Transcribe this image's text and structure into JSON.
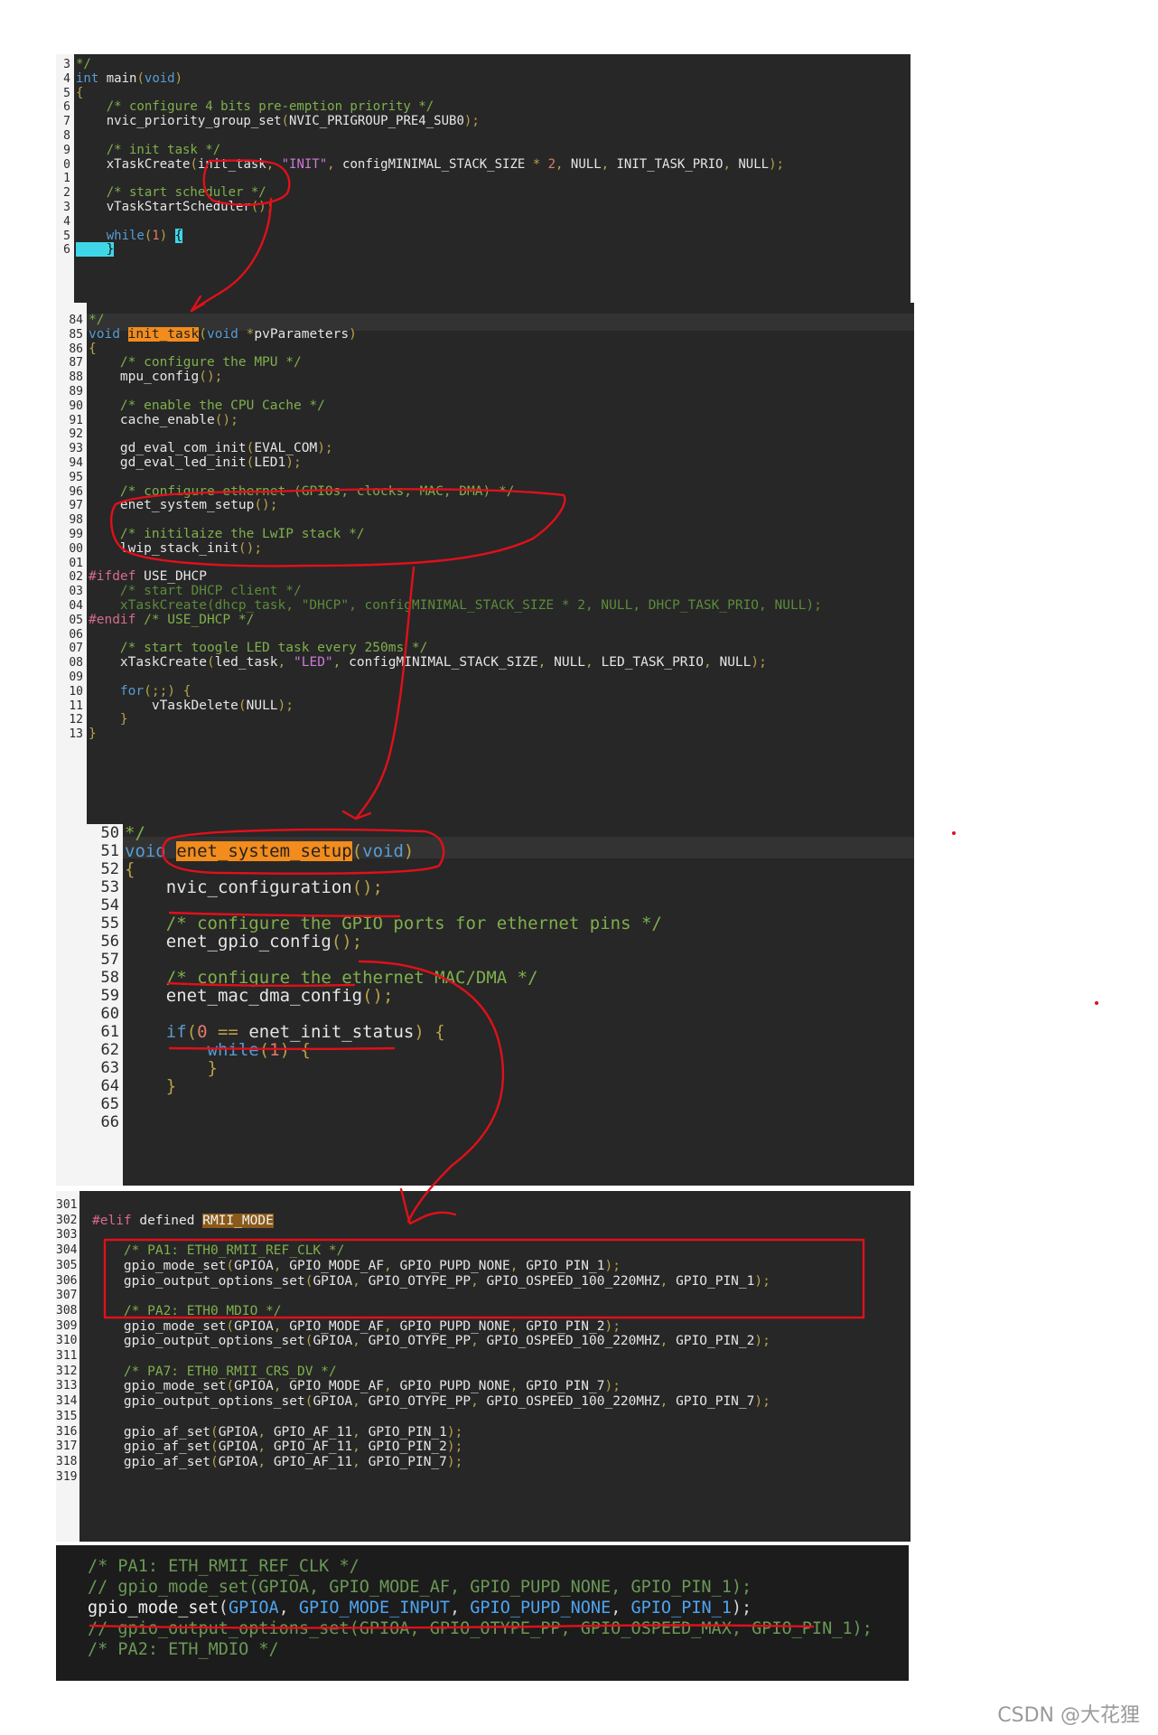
{
  "panel1": {
    "line_numbers": [
      "3",
      "4",
      "5",
      "6",
      "7",
      "8",
      "9",
      "0",
      "1",
      "2",
      "3",
      "4",
      "5",
      "6"
    ],
    "lines": [
      [
        [
          "cm",
          "*/"
        ]
      ],
      [
        [
          "kw",
          "int"
        ],
        [
          "id",
          " main"
        ],
        [
          "pn",
          "("
        ],
        [
          "kw",
          "void"
        ],
        [
          "pn",
          ")"
        ]
      ],
      [
        [
          "pn",
          "{"
        ]
      ],
      [
        [
          "cm",
          "    /* configure 4 bits pre-emption priority */"
        ]
      ],
      [
        [
          "id",
          "    nvic_priority_group_set"
        ],
        [
          "pn",
          "("
        ],
        [
          "id",
          "NVIC_PRIGROUP_PRE4_SUB0"
        ],
        [
          "pn",
          ");"
        ]
      ],
      [
        [
          "id",
          ""
        ]
      ],
      [
        [
          "cm",
          "    /* init task */"
        ]
      ],
      [
        [
          "id",
          "    xTaskCreate"
        ],
        [
          "pn",
          "("
        ],
        [
          "id",
          "init_task"
        ],
        [
          "pn",
          ", "
        ],
        [
          "str",
          "\"INIT\""
        ],
        [
          "pn",
          ", "
        ],
        [
          "id",
          "configMINIMAL_STACK_SIZE "
        ],
        [
          "pn",
          "* "
        ],
        [
          "num",
          "2"
        ],
        [
          "pn",
          ", "
        ],
        [
          "id",
          "NULL"
        ],
        [
          "pn",
          ", "
        ],
        [
          "id",
          "INIT_TASK_PRIO"
        ],
        [
          "pn",
          ", "
        ],
        [
          "id",
          "NULL"
        ],
        [
          "pn",
          ");"
        ]
      ],
      [
        [
          "id",
          ""
        ]
      ],
      [
        [
          "cm",
          "    /* start scheduler */"
        ]
      ],
      [
        [
          "id",
          "    vTaskStartScheduler"
        ],
        [
          "pn",
          "();"
        ]
      ],
      [
        [
          "id",
          ""
        ]
      ],
      [
        [
          "kw",
          "    while"
        ],
        [
          "pn",
          "("
        ],
        [
          "num",
          "1"
        ],
        [
          "pn",
          ") "
        ],
        [
          "cursor",
          "{"
        ]
      ],
      [
        [
          "cursor",
          "    }"
        ]
      ]
    ]
  },
  "panel2": {
    "line_numbers": [
      "84",
      "85",
      "86",
      "87",
      "88",
      "89",
      "90",
      "91",
      "92",
      "93",
      "94",
      "95",
      "96",
      "97",
      "98",
      "99",
      "00",
      "01",
      "02",
      "03",
      "04",
      "05",
      "06",
      "07",
      "08",
      "09",
      "10",
      "11",
      "12",
      "13"
    ],
    "lines": [
      [
        [
          "cm",
          "*/"
        ]
      ],
      [
        [
          "kw",
          "void "
        ],
        [
          "hl",
          "init_task"
        ],
        [
          "pn",
          "("
        ],
        [
          "kw",
          "void "
        ],
        [
          "pn",
          "*"
        ],
        [
          "id",
          "pvParameters"
        ],
        [
          "pn",
          ")"
        ]
      ],
      [
        [
          "pn",
          "{"
        ]
      ],
      [
        [
          "cm",
          "    /* configure the MPU */"
        ]
      ],
      [
        [
          "id",
          "    mpu_config"
        ],
        [
          "pn",
          "();"
        ]
      ],
      [
        [
          "id",
          ""
        ]
      ],
      [
        [
          "cm",
          "    /* enable the CPU Cache */"
        ]
      ],
      [
        [
          "id",
          "    cache_enable"
        ],
        [
          "pn",
          "();"
        ]
      ],
      [
        [
          "id",
          ""
        ]
      ],
      [
        [
          "id",
          "    gd_eval_com_init"
        ],
        [
          "pn",
          "("
        ],
        [
          "id",
          "EVAL_COM"
        ],
        [
          "pn",
          ");"
        ]
      ],
      [
        [
          "id",
          "    gd_eval_led_init"
        ],
        [
          "pn",
          "("
        ],
        [
          "id",
          "LED1"
        ],
        [
          "pn",
          ");"
        ]
      ],
      [
        [
          "id",
          ""
        ]
      ],
      [
        [
          "cm",
          "    /* configure ethernet (GPIOs, clocks, MAC, DMA) */"
        ]
      ],
      [
        [
          "id",
          "    enet_system_setup"
        ],
        [
          "pn",
          "();"
        ]
      ],
      [
        [
          "id",
          ""
        ]
      ],
      [
        [
          "cm",
          "    /* initilaize the LwIP stack */"
        ]
      ],
      [
        [
          "id",
          "    lwip_stack_init"
        ],
        [
          "pn",
          "();"
        ]
      ],
      [
        [
          "id",
          ""
        ]
      ],
      [
        [
          "pp",
          "#ifdef "
        ],
        [
          "id",
          "USE_DHCP"
        ]
      ],
      [
        [
          "dim",
          "    /* start DHCP client */"
        ]
      ],
      [
        [
          "dim",
          "    xTaskCreate(dhcp_task, \"DHCP\", configMINIMAL_STACK_SIZE * 2, NULL, DHCP_TASK_PRIO, NULL);"
        ]
      ],
      [
        [
          "pp",
          "#endif "
        ],
        [
          "cm",
          "/* USE_DHCP */"
        ]
      ],
      [
        [
          "id",
          ""
        ]
      ],
      [
        [
          "cm",
          "    /* start toogle LED task every 250ms */"
        ]
      ],
      [
        [
          "id",
          "    xTaskCreate"
        ],
        [
          "pn",
          "("
        ],
        [
          "id",
          "led_task"
        ],
        [
          "pn",
          ", "
        ],
        [
          "str",
          "\"LED\""
        ],
        [
          "pn",
          ", "
        ],
        [
          "id",
          "configMINIMAL_STACK_SIZE"
        ],
        [
          "pn",
          ", "
        ],
        [
          "id",
          "NULL"
        ],
        [
          "pn",
          ", "
        ],
        [
          "id",
          "LED_TASK_PRIO"
        ],
        [
          "pn",
          ", "
        ],
        [
          "id",
          "NULL"
        ],
        [
          "pn",
          ");"
        ]
      ],
      [
        [
          "id",
          ""
        ]
      ],
      [
        [
          "kw",
          "    for"
        ],
        [
          "pn",
          "(;;) {"
        ]
      ],
      [
        [
          "id",
          "        vTaskDelete"
        ],
        [
          "pn",
          "("
        ],
        [
          "id",
          "NULL"
        ],
        [
          "pn",
          ");"
        ]
      ],
      [
        [
          "pn",
          "    }"
        ]
      ],
      [
        [
          "pn",
          "}"
        ]
      ]
    ]
  },
  "panel3": {
    "line_numbers": [
      "50",
      "51",
      "52",
      "53",
      "54",
      "55",
      "56",
      "57",
      "58",
      "59",
      "60",
      "61",
      "62",
      "63",
      "64",
      "65",
      "66"
    ],
    "lines": [
      [
        [
          "cm",
          "*/"
        ]
      ],
      [
        [
          "kw",
          "void "
        ],
        [
          "hl",
          "enet_system_setup"
        ],
        [
          "pn",
          "("
        ],
        [
          "kw",
          "void"
        ],
        [
          "pn",
          ")"
        ]
      ],
      [
        [
          "pn",
          "{"
        ]
      ],
      [
        [
          "id",
          "    nvic_configuration"
        ],
        [
          "pn",
          "();"
        ]
      ],
      [
        [
          "id",
          ""
        ]
      ],
      [
        [
          "cm",
          "    /* configure the GPIO ports for ethernet pins */"
        ]
      ],
      [
        [
          "id",
          "    enet_gpio_config"
        ],
        [
          "pn",
          "();"
        ]
      ],
      [
        [
          "id",
          ""
        ]
      ],
      [
        [
          "cm",
          "    /* configure the ethernet MAC/DMA */"
        ]
      ],
      [
        [
          "id",
          "    enet_mac_dma_config"
        ],
        [
          "pn",
          "();"
        ]
      ],
      [
        [
          "id",
          ""
        ]
      ],
      [
        [
          "kw",
          "    if"
        ],
        [
          "pn",
          "("
        ],
        [
          "num",
          "0"
        ],
        [
          "pn",
          " == "
        ],
        [
          "id",
          "enet_init_status"
        ],
        [
          "pn",
          ") {"
        ]
      ],
      [
        [
          "kw",
          "        while"
        ],
        [
          "pn",
          "("
        ],
        [
          "num",
          "1"
        ],
        [
          "pn",
          ") {"
        ]
      ],
      [
        [
          "pn",
          "        }"
        ]
      ],
      [
        [
          "pn",
          "    }"
        ]
      ],
      [
        [
          "id",
          ""
        ]
      ],
      [
        [
          "id",
          ""
        ]
      ]
    ]
  },
  "panel4": {
    "line_numbers": [
      "301",
      "302",
      "303",
      "304",
      "305",
      "306",
      "307",
      "308",
      "309",
      "310",
      "311",
      "312",
      "313",
      "314",
      "315",
      "316",
      "317",
      "318",
      "319"
    ],
    "lines": [
      [
        [
          "id",
          ""
        ]
      ],
      [
        [
          "pp",
          "#elif "
        ],
        [
          "id",
          "defined "
        ],
        [
          "hl2",
          "RMII_MODE"
        ]
      ],
      [
        [
          "id",
          ""
        ]
      ],
      [
        [
          "cm",
          "    /* PA1: ETH0_RMII_REF_CLK */"
        ]
      ],
      [
        [
          "id",
          "    gpio_mode_set"
        ],
        [
          "pn",
          "("
        ],
        [
          "id",
          "GPIOA"
        ],
        [
          "pn",
          ", "
        ],
        [
          "id",
          "GPIO_MODE_AF"
        ],
        [
          "pn",
          ", "
        ],
        [
          "id",
          "GPIO_PUPD_NONE"
        ],
        [
          "pn",
          ", "
        ],
        [
          "id",
          "GPIO_PIN_1"
        ],
        [
          "pn",
          ");"
        ]
      ],
      [
        [
          "id",
          "    gpio_output_options_set"
        ],
        [
          "pn",
          "("
        ],
        [
          "id",
          "GPIOA"
        ],
        [
          "pn",
          ", "
        ],
        [
          "id",
          "GPIO_OTYPE_PP"
        ],
        [
          "pn",
          ", "
        ],
        [
          "id",
          "GPIO_OSPEED_100_220MHZ"
        ],
        [
          "pn",
          ", "
        ],
        [
          "id",
          "GPIO_PIN_1"
        ],
        [
          "pn",
          ");"
        ]
      ],
      [
        [
          "id",
          ""
        ]
      ],
      [
        [
          "cm",
          "    /* PA2: ETH0_MDIO */"
        ]
      ],
      [
        [
          "id",
          "    gpio_mode_set"
        ],
        [
          "pn",
          "("
        ],
        [
          "id",
          "GPIOA"
        ],
        [
          "pn",
          ", "
        ],
        [
          "id",
          "GPIO_MODE_AF"
        ],
        [
          "pn",
          ", "
        ],
        [
          "id",
          "GPIO_PUPD_NONE"
        ],
        [
          "pn",
          ", "
        ],
        [
          "id",
          "GPIO_PIN_2"
        ],
        [
          "pn",
          ");"
        ]
      ],
      [
        [
          "id",
          "    gpio_output_options_set"
        ],
        [
          "pn",
          "("
        ],
        [
          "id",
          "GPIOA"
        ],
        [
          "pn",
          ", "
        ],
        [
          "id",
          "GPIO_OTYPE_PP"
        ],
        [
          "pn",
          ", "
        ],
        [
          "id",
          "GPIO_OSPEED_100_220MHZ"
        ],
        [
          "pn",
          ", "
        ],
        [
          "id",
          "GPIO_PIN_2"
        ],
        [
          "pn",
          ");"
        ]
      ],
      [
        [
          "id",
          ""
        ]
      ],
      [
        [
          "cm",
          "    /* PA7: ETH0_RMII_CRS_DV */"
        ]
      ],
      [
        [
          "id",
          "    gpio_mode_set"
        ],
        [
          "pn",
          "("
        ],
        [
          "id",
          "GPIOA"
        ],
        [
          "pn",
          ", "
        ],
        [
          "id",
          "GPIO_MODE_AF"
        ],
        [
          "pn",
          ", "
        ],
        [
          "id",
          "GPIO_PUPD_NONE"
        ],
        [
          "pn",
          ", "
        ],
        [
          "id",
          "GPIO_PIN_7"
        ],
        [
          "pn",
          ");"
        ]
      ],
      [
        [
          "id",
          "    gpio_output_options_set"
        ],
        [
          "pn",
          "("
        ],
        [
          "id",
          "GPIOA"
        ],
        [
          "pn",
          ", "
        ],
        [
          "id",
          "GPIO_OTYPE_PP"
        ],
        [
          "pn",
          ", "
        ],
        [
          "id",
          "GPIO_OSPEED_100_220MHZ"
        ],
        [
          "pn",
          ", "
        ],
        [
          "id",
          "GPIO_PIN_7"
        ],
        [
          "pn",
          ");"
        ]
      ],
      [
        [
          "id",
          ""
        ]
      ],
      [
        [
          "id",
          "    gpio_af_set"
        ],
        [
          "pn",
          "("
        ],
        [
          "id",
          "GPIOA"
        ],
        [
          "pn",
          ", "
        ],
        [
          "id",
          "GPIO_AF_11"
        ],
        [
          "pn",
          ", "
        ],
        [
          "id",
          "GPIO_PIN_1"
        ],
        [
          "pn",
          ");"
        ]
      ],
      [
        [
          "id",
          "    gpio_af_set"
        ],
        [
          "pn",
          "("
        ],
        [
          "id",
          "GPIOA"
        ],
        [
          "pn",
          ", "
        ],
        [
          "id",
          "GPIO_AF_11"
        ],
        [
          "pn",
          ", "
        ],
        [
          "id",
          "GPIO_PIN_2"
        ],
        [
          "pn",
          ");"
        ]
      ],
      [
        [
          "id",
          "    gpio_af_set"
        ],
        [
          "pn",
          "("
        ],
        [
          "id",
          "GPIOA"
        ],
        [
          "pn",
          ", "
        ],
        [
          "id",
          "GPIO_AF_11"
        ],
        [
          "pn",
          ", "
        ],
        [
          "id",
          "GPIO_PIN_7"
        ],
        [
          "pn",
          ");"
        ]
      ],
      [
        [
          "id",
          ""
        ]
      ]
    ]
  },
  "panel5": {
    "lines": [
      [
        [
          "cm5",
          "/* PA1: ETH_RMII_REF_CLK */"
        ]
      ],
      [
        [
          "cm5",
          "// gpio_mode_set(GPIOA, GPIO_MODE_AF, GPIO_PUPD_NONE, GPIO_PIN_1);"
        ]
      ],
      [
        [
          "fn5",
          "gpio_mode_set"
        ],
        [
          "pu5",
          "("
        ],
        [
          "cn5",
          "GPIOA"
        ],
        [
          "pu5",
          ", "
        ],
        [
          "cn5",
          "GPIO_MODE_INPUT"
        ],
        [
          "pu5",
          ", "
        ],
        [
          "cn5",
          "GPIO_PUPD_NONE"
        ],
        [
          "pu5",
          ", "
        ],
        [
          "cn5",
          "GPIO_PIN_1"
        ],
        [
          "pu5",
          ");"
        ]
      ],
      [
        [
          "cm5",
          "// gpio_output_options_set(GPIOA, GPIO_OTYPE_PP, GPIO_OSPEED_MAX, GPIO_PIN_1);"
        ]
      ],
      [
        [
          "cm5",
          "/* PA2: ETH_MDIO */"
        ]
      ]
    ]
  },
  "watermark": "CSDN @大花狸",
  "colors": {
    "annotation": "#e0101a",
    "highlight": "#f28c1c",
    "editor_bg": "#272727"
  }
}
